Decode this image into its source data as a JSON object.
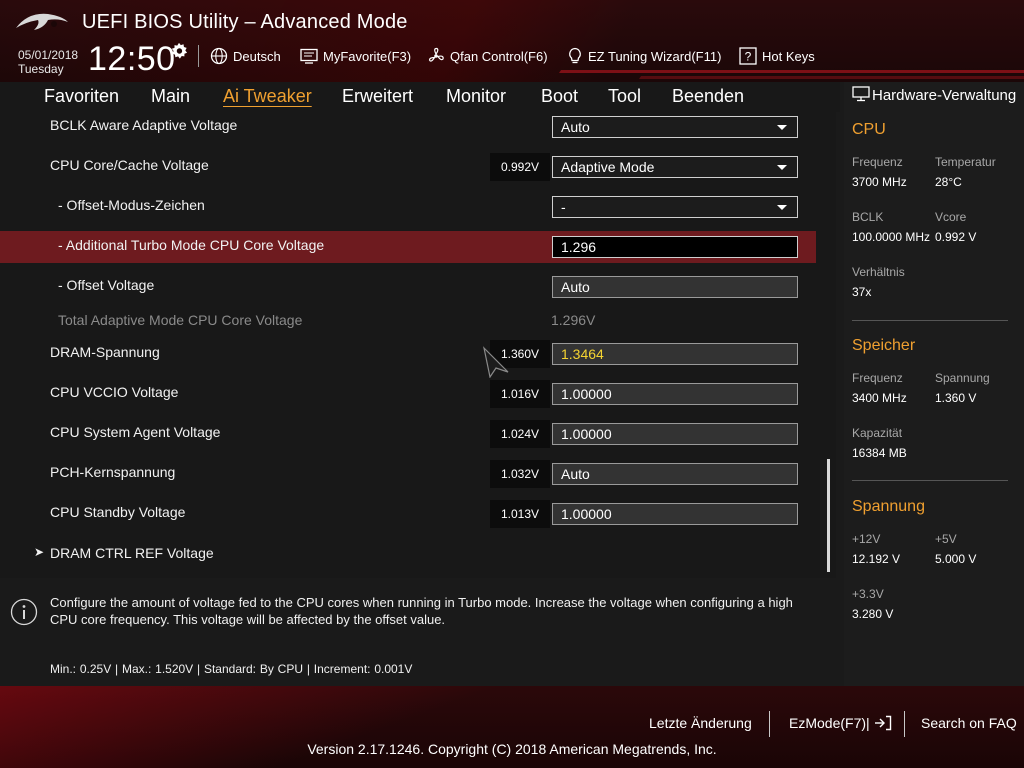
{
  "header": {
    "title": "UEFI BIOS Utility – Advanced Mode",
    "date": "05/01/2018",
    "day": "Tuesday",
    "time": "12:50",
    "toolbar": [
      {
        "label": "Deutsch",
        "icon": "globe-icon"
      },
      {
        "label": "MyFavorite(F3)",
        "icon": "favorite-screen-icon"
      },
      {
        "label": "Qfan Control(F6)",
        "icon": "fan-icon"
      },
      {
        "label": "EZ Tuning Wizard(F11)",
        "icon": "lightbulb-icon"
      },
      {
        "label": "Hot Keys",
        "icon": "question-box-icon"
      }
    ]
  },
  "menu": {
    "tabs": [
      "Favoriten",
      "Main",
      "Ai Tweaker",
      "Erweitert",
      "Monitor",
      "Boot",
      "Tool",
      "Beenden"
    ],
    "active": "Ai Tweaker"
  },
  "settings": [
    {
      "label": "BCLK Aware Adaptive Voltage",
      "value": "Auto",
      "control": "select"
    },
    {
      "label": "CPU Core/Cache Voltage",
      "reading": "0.992V",
      "value": "Adaptive Mode",
      "control": "select"
    },
    {
      "label": "- Offset-Modus-Zeichen",
      "value": "-",
      "control": "select"
    },
    {
      "label": "- Additional Turbo Mode CPU Core Voltage",
      "value": "1.296",
      "control": "input",
      "selected": true
    },
    {
      "label": "- Offset Voltage",
      "value": "Auto",
      "control": "input"
    },
    {
      "label": "Total Adaptive Mode CPU Core Voltage",
      "value": "1.296V",
      "control": "text"
    },
    {
      "label": "DRAM-Spannung",
      "reading": "1.360V",
      "value": "1.3464",
      "control": "input",
      "value_color": "#f5d431"
    },
    {
      "label": "CPU VCCIO Voltage",
      "reading": "1.016V",
      "value": "1.00000",
      "control": "input"
    },
    {
      "label": "CPU System Agent Voltage",
      "reading": "1.024V",
      "value": "1.00000",
      "control": "input"
    },
    {
      "label": "PCH-Kernspannung",
      "reading": "1.032V",
      "value": "Auto",
      "control": "input"
    },
    {
      "label": "CPU Standby Voltage",
      "reading": "1.013V",
      "value": "1.00000",
      "control": "input"
    },
    {
      "label": "DRAM CTRL REF Voltage",
      "control": "submenu"
    }
  ],
  "help": {
    "description": "Configure the amount of voltage fed to the CPU cores when running in Turbo mode. Increase the voltage when configuring a high CPU core frequency. This voltage will be affected by the offset value.",
    "range": "Min.: 0.25V   |   Max.: 1.520V   |   Standard: By CPU   |   Increment: 0.001V"
  },
  "hardware_monitor": {
    "title": "Hardware-Verwaltung",
    "cpu": {
      "title": "CPU",
      "frequency_label": "Frequenz",
      "frequency": "3700 MHz",
      "temperature_label": "Temperatur",
      "temperature": "28°C",
      "bclk_label": "BCLK",
      "bclk": "100.0000 MHz",
      "vcore_label": "Vcore",
      "vcore": "0.992 V",
      "ratio_label": "Verhältnis",
      "ratio": "37x"
    },
    "memory": {
      "title": "Speicher",
      "frequency_label": "Frequenz",
      "frequency": "3400 MHz",
      "voltage_label": "Spannung",
      "voltage": "1.360 V",
      "capacity_label": "Kapazität",
      "capacity": "16384 MB"
    },
    "voltage": {
      "title": "Spannung",
      "v12_label": "+12V",
      "v12": "12.192 V",
      "v5_label": "+5V",
      "v5": "5.000 V",
      "v33_label": "+3.3V",
      "v33": "3.280 V"
    }
  },
  "footer": {
    "last_change": "Letzte Änderung",
    "ezmode": "EzMode(F7)|",
    "search_faq": "Search on FAQ",
    "copyright": "Version 2.17.1246. Copyright (C) 2018 American Megatrends, Inc."
  },
  "colors": {
    "accent": "#f0a030",
    "selected_row": "#6e1b1f",
    "modified_value": "#f5d431"
  }
}
